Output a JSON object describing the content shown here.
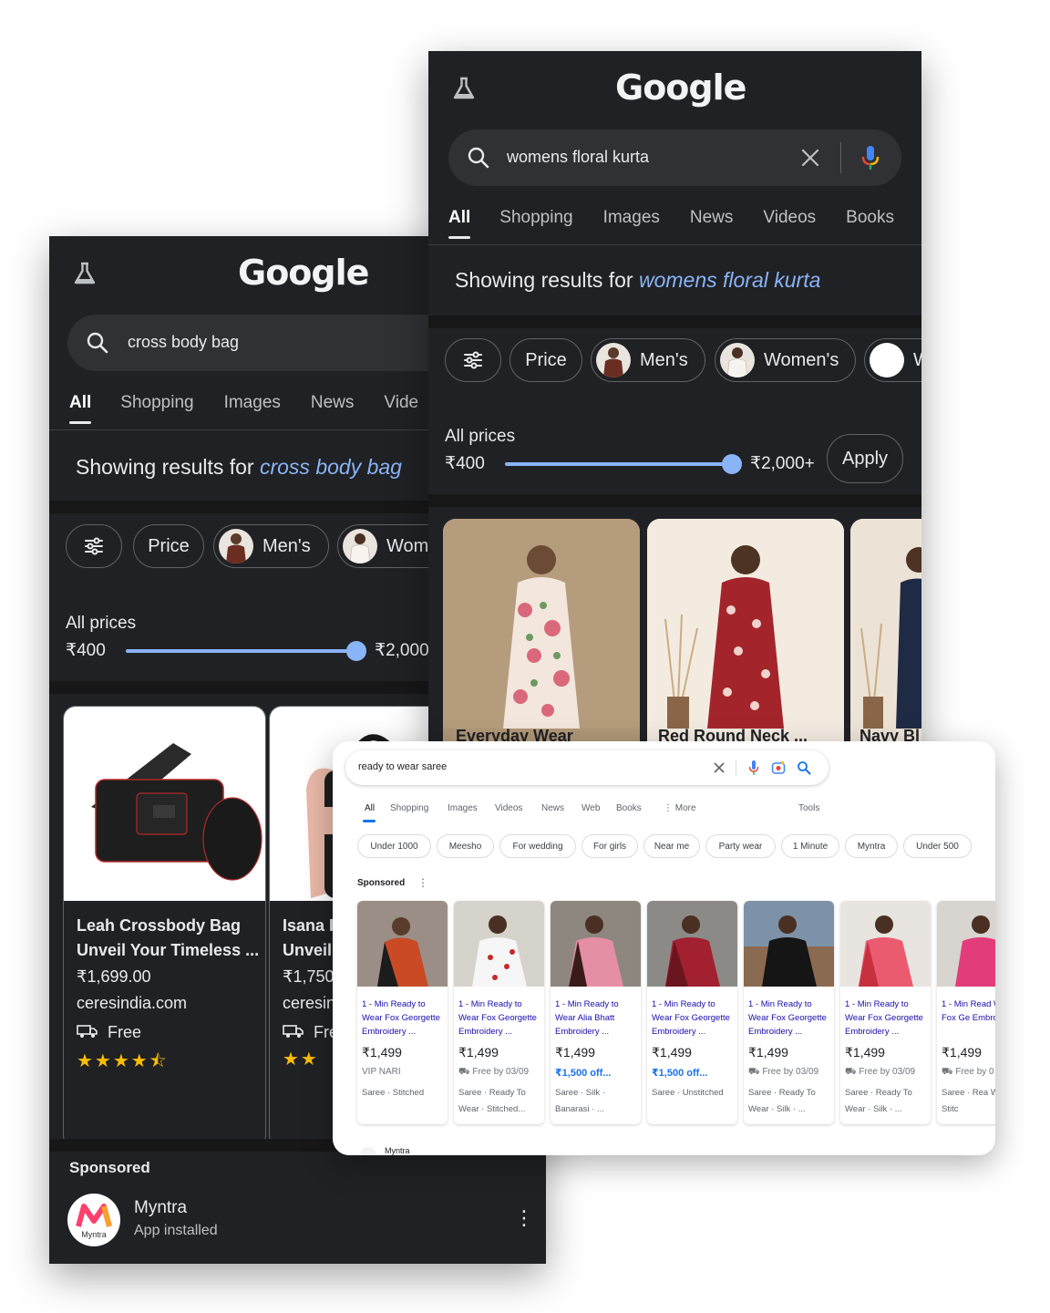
{
  "left_phone": {
    "logo": "Google",
    "search_query": "cross body bag",
    "tabs": [
      "All",
      "Shopping",
      "Images",
      "News",
      "Vide"
    ],
    "showing_prefix": "Showing results for",
    "showing_query": "cross body bag",
    "chips": [
      "Price",
      "Men's",
      "Wom"
    ],
    "price_label": "All prices",
    "price_min": "₹400",
    "price_max": "₹2,000",
    "products": [
      {
        "title1": "Leah Crossbody Bag",
        "title2": "Unveil Your Timeless ...",
        "price": "₹1,699.00",
        "store": "ceresindia.com",
        "delivery": "Free",
        "stars": "★★★★⯪"
      },
      {
        "title1": "Isana I",
        "title2": "Unveil",
        "price": "₹1,750.",
        "store": "ceresin",
        "delivery": "Fre",
        "stars": "★★"
      }
    ],
    "sponsored_label": "Sponsored",
    "ad_name": "Myntra",
    "ad_sub": "App installed",
    "ad_logo_text": "Myntra"
  },
  "right_phone": {
    "logo": "Google",
    "search_query": "womens floral kurta",
    "tabs": [
      "All",
      "Shopping",
      "Images",
      "News",
      "Videos",
      "Books"
    ],
    "showing_prefix": "Showing results for",
    "showing_query": "womens floral kurta",
    "chips": [
      "Price",
      "Men's",
      "Women's",
      "W"
    ],
    "price_label": "All prices",
    "price_min": "₹400",
    "price_max": "₹2,000+",
    "apply_label": "Apply",
    "products": [
      "Everyday Wear",
      "Red Round Neck ...",
      "Navy Bl"
    ]
  },
  "desktop": {
    "search_query": "ready to wear saree",
    "tabs": [
      "All",
      "Shopping",
      "Images",
      "Videos",
      "News",
      "Web",
      "Books",
      "⋮ More",
      "Tools"
    ],
    "chips": [
      "Under 1000",
      "Meesho",
      "For wedding",
      "For girls",
      "Near me",
      "Party wear",
      "1 Minute",
      "Myntra",
      "Under 500"
    ],
    "sponsored_label": "Sponsored",
    "bottom_store": "Myntra",
    "products": [
      {
        "title": "1 - Min Ready to Wear Fox Georgette Embroidery ...",
        "price": "₹1,499",
        "extra": "VIP NARI",
        "extra_type": "store",
        "tags": "Saree · Stitched"
      },
      {
        "title": "1 - Min Ready to Wear Fox Georgette Embroidery ...",
        "price": "₹1,499",
        "extra": "⛟ Free by 03/09",
        "extra_type": "ship",
        "tags": "Saree · Ready To Wear · Stitched..."
      },
      {
        "title": "1 - Min Ready to Wear Alia Bhatt Embroidery ...",
        "price": "₹1,499",
        "extra": "₹1,500 off...",
        "extra_type": "off",
        "tags": "Saree · Silk · Banarasi · ..."
      },
      {
        "title": "1 - Min Ready to Wear Fox Georgette Embroidery ...",
        "price": "₹1,499",
        "extra": "₹1,500 off...",
        "extra_type": "off",
        "tags": "Saree · Unstitched"
      },
      {
        "title": "1 - Min Ready to Wear Fox Georgette Embroidery ...",
        "price": "₹1,499",
        "extra": "⛟ Free by 03/09",
        "extra_type": "ship",
        "tags": "Saree · Ready To Wear · Silk · ..."
      },
      {
        "title": "1 - Min Ready to Wear Fox Georgette Embroidery ...",
        "price": "₹1,499",
        "extra": "⛟ Free by 03/09",
        "extra_type": "ship",
        "tags": "Saree · Ready To Wear · Silk · ..."
      },
      {
        "title": "1 - Min Read Wear Fox Ge Embroidery",
        "price": "₹1,499",
        "extra": "⛟ Free by 0",
        "extra_type": "ship",
        "tags": "Saree · Rea Wear · Stitc"
      }
    ]
  },
  "colors": {
    "accent_blue": "#8ab4f8",
    "dark_bg": "#202124",
    "link_blue": "#1a0dab",
    "star": "#fbbc04"
  }
}
